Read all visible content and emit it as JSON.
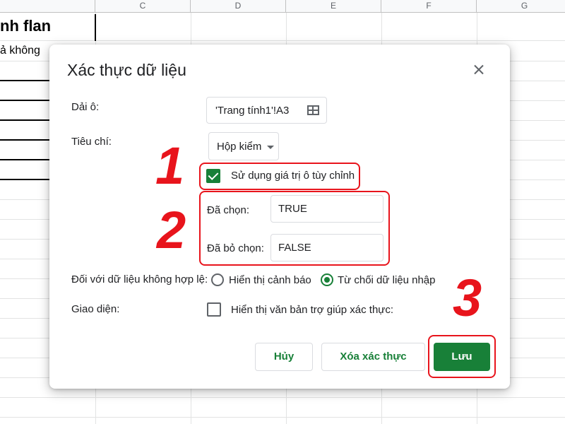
{
  "sheet": {
    "columns": [
      "C",
      "D",
      "E",
      "F",
      "G"
    ],
    "title_cell": "nh flan",
    "second_cell": "ả không"
  },
  "dialog": {
    "title": "Xác thực dữ liệu",
    "range_label": "Dải ô:",
    "range_value": "'Trang tính1'!A3",
    "criteria_label": "Tiêu chí:",
    "criteria_value": "Hộp kiểm",
    "custom_values_label": "Sử dụng giá trị ô tùy chỉnh",
    "checked_label": "Đã chọn:",
    "checked_value": "TRUE",
    "unchecked_label": "Đã bỏ chọn:",
    "unchecked_value": "FALSE",
    "invalid_label": "Đối với dữ liệu không hợp lệ:",
    "invalid_options": [
      "Hiển thị cảnh báo",
      "Từ chối dữ liệu nhập"
    ],
    "invalid_selected": "Từ chối dữ liệu nhập",
    "appearance_label": "Giao diện:",
    "appearance_option": "Hiển thị văn bản trợ giúp xác thực:",
    "buttons": {
      "cancel": "Hủy",
      "remove": "Xóa xác thực",
      "save": "Lưu"
    }
  },
  "annotations": {
    "step1": "1",
    "step2": "2",
    "step3": "3"
  },
  "colors": {
    "accent_green": "#188038",
    "annotation_red": "#e8141c"
  }
}
